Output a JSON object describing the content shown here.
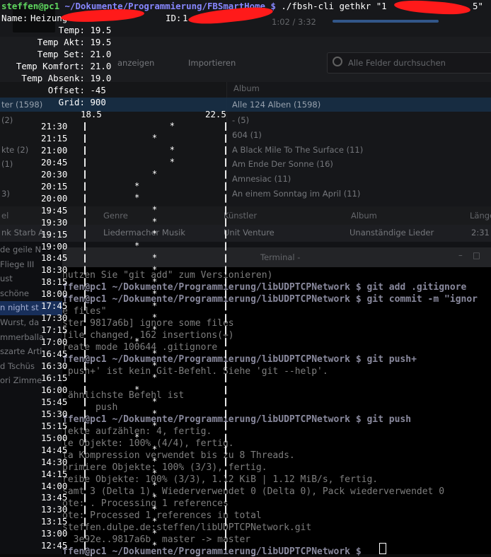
{
  "terminal": {
    "prompt": {
      "user_host": "steffen@pc1",
      "path": "~/Dokumente/Programmierung/FBSmartHome",
      "symbol": "$",
      "command": "./fbsh-cli gethkr \"1",
      "command_tail": "5\""
    },
    "info": {
      "name_label": "Name:",
      "name_value": "Heizung",
      "id_label": "ID:",
      "id_value": "1",
      "rows": [
        {
          "label": "Temp:",
          "value": "19.5"
        },
        {
          "label": "Temp Akt:",
          "value": "19.5"
        },
        {
          "label": "Temp Set:",
          "value": "21.0"
        },
        {
          "label": "Temp Komfort:",
          "value": "21.0"
        },
        {
          "label": "Temp Absenk:",
          "value": "19.0"
        },
        {
          "label": "Offset:",
          "value": "-45"
        },
        {
          "label": "Grid:",
          "value": "900"
        }
      ]
    },
    "plot": {
      "axis_min_label": "18.5",
      "axis_max_label": "22.5",
      "marker": "*",
      "points": [
        {
          "time": "21:30",
          "value": 21.0
        },
        {
          "time": "21:15",
          "value": 20.5
        },
        {
          "time": "21:00",
          "value": 21.0
        },
        {
          "time": "20:45",
          "value": 21.0
        },
        {
          "time": "20:30",
          "value": 20.5
        },
        {
          "time": "20:15",
          "value": 20.0
        },
        {
          "time": "20:00",
          "value": 20.0
        },
        {
          "time": "19:45",
          "value": 20.5
        },
        {
          "time": "19:30",
          "value": 20.5
        },
        {
          "time": "19:15",
          "value": 20.5
        },
        {
          "time": "19:00",
          "value": 20.0
        },
        {
          "time": "18:45",
          "value": 20.5
        },
        {
          "time": "18:30",
          "value": 20.5
        },
        {
          "time": "18:15",
          "value": 20.5
        },
        {
          "time": "18:00",
          "value": 20.5
        },
        {
          "time": "17:45",
          "value": 20.5
        },
        {
          "time": "17:30",
          "value": 20.5
        },
        {
          "time": "17:15",
          "value": 20.5
        },
        {
          "time": "17:00",
          "value": 20.0
        },
        {
          "time": "16:45",
          "value": 20.5
        },
        {
          "time": "16:30",
          "value": 20.5
        },
        {
          "time": "16:15",
          "value": 20.5
        },
        {
          "time": "16:00",
          "value": 20.0
        },
        {
          "time": "15:45",
          "value": 20.5
        },
        {
          "time": "15:30",
          "value": 20.5
        },
        {
          "time": "15:15",
          "value": 20.5
        },
        {
          "time": "15:00",
          "value": 20.0
        },
        {
          "time": "14:45",
          "value": 20.5
        },
        {
          "time": "14:30",
          "value": 20.5
        },
        {
          "time": "14:15",
          "value": 20.5
        },
        {
          "time": "14:00",
          "value": 20.5
        },
        {
          "time": "13:45",
          "value": 20.5
        },
        {
          "time": "13:30",
          "value": 20.5
        },
        {
          "time": "13:15",
          "value": 20.5
        },
        {
          "time": "13:00",
          "value": 20.5
        },
        {
          "time": "12:45",
          "value": 20.5
        }
      ]
    }
  },
  "background_player": {
    "search_placeholder": "Alle Felder durchsuchen",
    "toolbar_items": [
      "anzeigen",
      "Importieren"
    ],
    "duration": "1:02 / 3:32",
    "column_album": "Album",
    "album_all": "Alle 124 Alben (1598)",
    "artist_all": "ter (1598)",
    "albums": [
      "- (5)",
      "604 (1)",
      "A Black Mile To The Surface (11)",
      "Am Ende Der Sonne (16)",
      "Amnesiac (11)",
      "An einem Sonntag im April (11)"
    ],
    "artists_partial": [
      "(2)",
      "",
      "kte (2)",
      "(1)",
      "",
      "3)"
    ],
    "table_headers": [
      "el",
      "Genre",
      "Künstler",
      "Album",
      "Länge"
    ],
    "table_row": [
      "nk Starb A...",
      "Liedermacher Musik",
      "Unit Venture",
      "Unanständige Lieder",
      "2:31"
    ],
    "left_list": [
      "de geile N",
      "Fliege III",
      "ust",
      "schöne",
      "n night st",
      "Wurst, da",
      "mmerballa",
      "szarte Arti",
      "d Tschüs",
      "ori Zimme"
    ],
    "terminal_title": "Terminal - "
  },
  "background_terminal": {
    "lines": [
      "nutzen Sie \"git add\" zum Versionieren)",
      "ffen@pc1 ~/Dokumente/Programmierung/libUDPTCPNetwork $ git add .gitignore",
      "ffen@pc1 ~/Dokumente/Programmierung/libUDPTCPNetwork $ git commit -m \"ignor",
      "e files\"",
      "ster 9817a6b] ignore some files",
      "file changed, 162 insertions(+)",
      "reate mode 100644 .gitignore",
      "ffen@pc1 ~/Dokumente/Programmierung/libUDPTCPNetwork $ git push+",
      "'push+' ist kein Git-Befehl. Siehe 'git --help'.",
      "",
      " ähnlichste Befehl ist",
      "      push",
      "ffen@pc1 ~/Dokumente/Programmierung/libUDPTCPNetwork $ git push",
      "jekte aufzählen: 4, fertig.",
      "le Objekte: 100% (4/4), fertig.",
      "ta Kompression verwendet bis zu 8 Threads.",
      "primiere Objekte: 100% (3/3), fertig.",
      "reibe Objekte: 100% (3/3), 1.12 KiB | 1.12 MiB/s, fertig.",
      "samt 3 (Delta 1), Wiederverwendet 0 (Delta 0), Pack wiederverwendet 0",
      "ote: . Processing 1 references",
      "ote: Processed 1 references in total",
      "steffen.dulpe.de:steffen/libUDPTCPNetwork.git",
      "  3e92e..9817a6b  master -> master",
      "ffen@pc1 ~/Dokumente/Programmierung/libUDPTCPNetwork $"
    ]
  }
}
